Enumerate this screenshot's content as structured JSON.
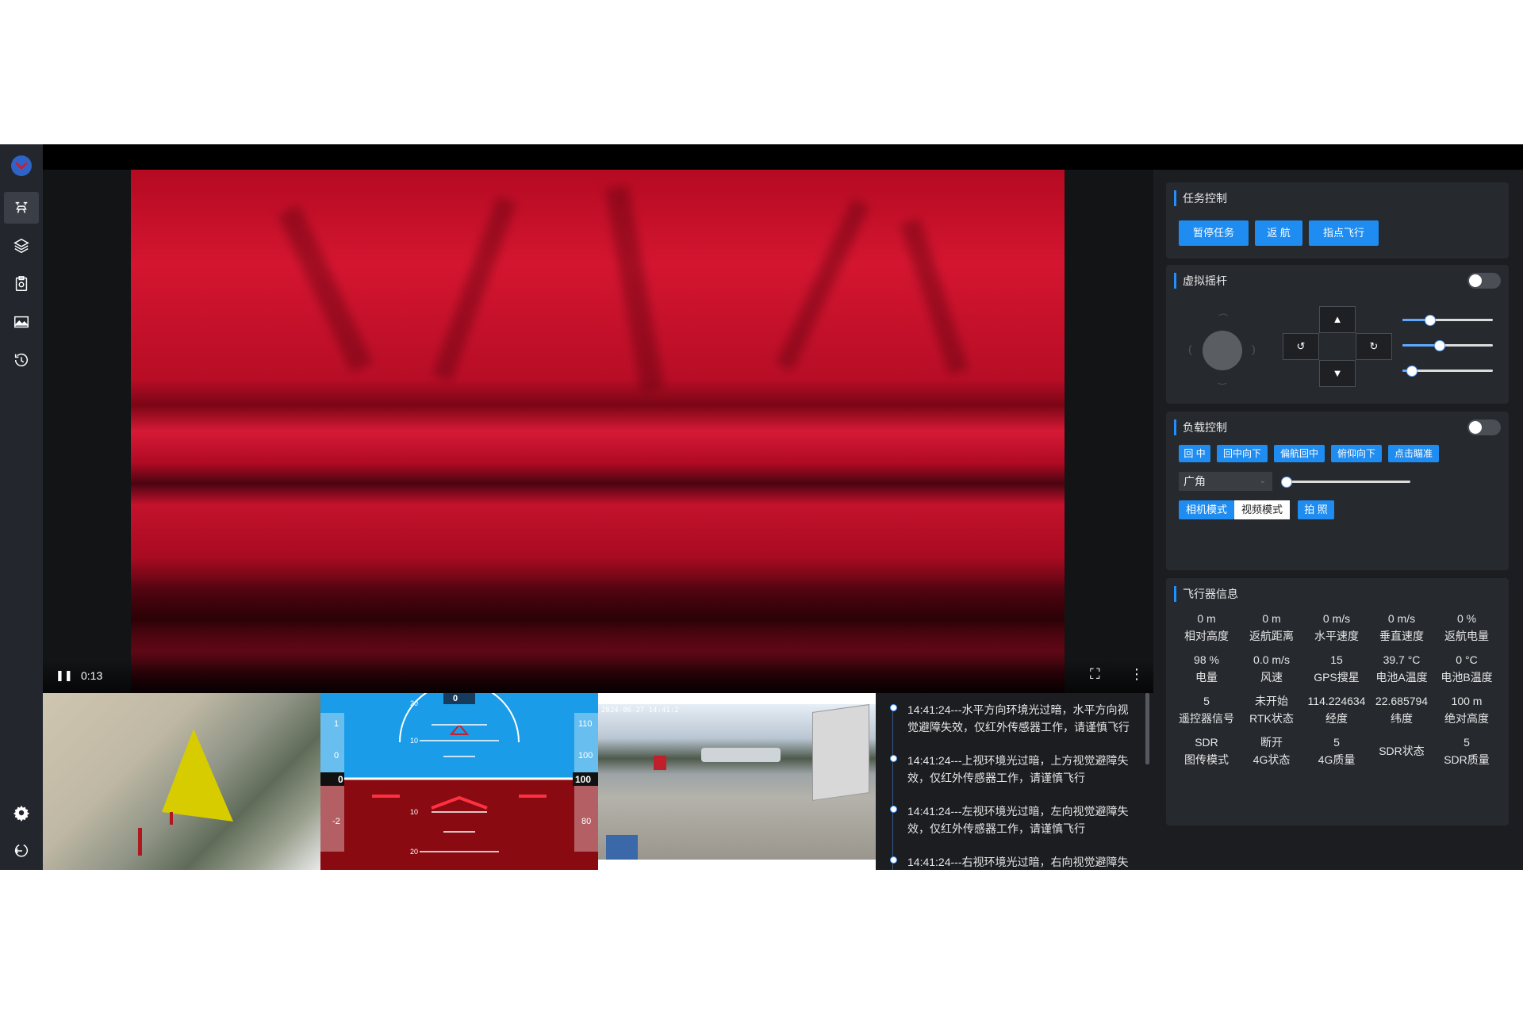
{
  "video": {
    "time": "0:13"
  },
  "attitude": {
    "heading_top": "0",
    "pitch_top": "20",
    "pitch_up": "10",
    "pitch_down1": "10",
    "pitch_down2": "20",
    "left_scale": [
      "1",
      "0",
      "0",
      "-2"
    ],
    "right_scale": [
      "110",
      "100",
      "100",
      "80"
    ]
  },
  "camera2": {
    "timestamp": "2024-06-27 14:41:2"
  },
  "log": {
    "entries": [
      "14:41:24---水平方向环境光过暗，水平方向视觉避障失效，仅红外传感器工作，请谨慎飞行",
      "14:41:24---上视环境光过暗，上方视觉避障失效，仅红外传感器工作，请谨慎飞行",
      "14:41:24---左视环境光过暗，左向视觉避障失效，仅红外传感器工作，请谨慎飞行",
      "14:41:24---右视环境光过暗，右向视觉避障失"
    ]
  },
  "mission": {
    "title": "任务控制",
    "buttons": [
      "暂停任务",
      "返 航",
      "指点飞行"
    ]
  },
  "joystick": {
    "title": "虚拟摇杆",
    "enabled": false,
    "up": "▲",
    "down": "▼",
    "rotate_left": "↺",
    "rotate_right": "↻",
    "sliders": [
      0.3,
      0.4,
      0.1
    ]
  },
  "payload": {
    "title": "负载控制",
    "enabled": false,
    "buttons": [
      "回 中",
      "回中向下",
      "偏航回中",
      "俯仰向下",
      "点击瞄准"
    ],
    "lens_value": "广角",
    "zoom": 0.02,
    "mode_camera": "相机模式",
    "mode_video": "视频模式",
    "photo": "拍 照"
  },
  "flight_info": {
    "title": "飞行器信息",
    "items": [
      {
        "value": "0 m",
        "label": "相对高度"
      },
      {
        "value": "0 m",
        "label": "返航距离"
      },
      {
        "value": "0 m/s",
        "label": "水平速度"
      },
      {
        "value": "0 m/s",
        "label": "垂直速度"
      },
      {
        "value": "0 %",
        "label": "返航电量"
      },
      {
        "value": "98 %",
        "label": "电量"
      },
      {
        "value": "0.0 m/s",
        "label": "风速"
      },
      {
        "value": "15",
        "label": "GPS搜星"
      },
      {
        "value": "39.7 °C",
        "label": "电池A温度"
      },
      {
        "value": "0 °C",
        "label": "电池B温度"
      },
      {
        "value": "5",
        "label": "遥控器信号"
      },
      {
        "value": "未开始",
        "label": "RTK状态"
      },
      {
        "value": "114.224634",
        "label": "经度"
      },
      {
        "value": "22.685794",
        "label": "纬度"
      },
      {
        "value": "100 m",
        "label": "绝对高度"
      },
      {
        "value": "SDR",
        "label": "图传模式"
      },
      {
        "value": "断开",
        "label": "4G状态"
      },
      {
        "value": "5",
        "label": "4G质量"
      },
      {
        "value": "",
        "label": "SDR状态"
      },
      {
        "value": "5",
        "label": "SDR质量"
      }
    ]
  },
  "colors": {
    "accent": "#1e8cf0",
    "panel": "#26292e",
    "background": "#1b1d20"
  }
}
